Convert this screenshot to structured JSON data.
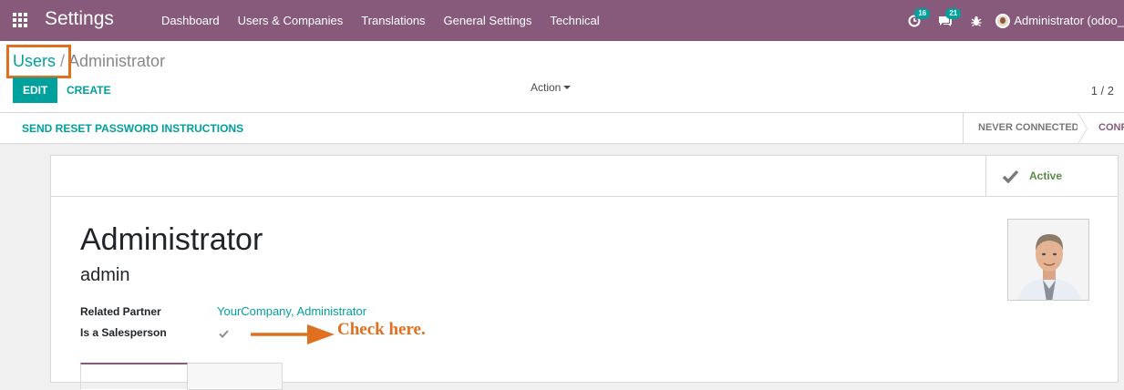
{
  "app": {
    "title": "Settings"
  },
  "menu": {
    "items": [
      {
        "label": "Dashboard"
      },
      {
        "label": "Users & Companies"
      },
      {
        "label": "Translations"
      },
      {
        "label": "General Settings"
      },
      {
        "label": "Technical"
      }
    ]
  },
  "systray": {
    "activity_count": "16",
    "messages_count": "21",
    "user_label": "Administrator (odoo_"
  },
  "breadcrumb": {
    "parent": "Users",
    "separator": "/",
    "current": "Administrator"
  },
  "toolbar": {
    "edit_label": "EDIT",
    "create_label": "CREATE",
    "action_label": "Action",
    "pager": "1 / 2"
  },
  "statusbar": {
    "reset_password_label": "SEND RESET PASSWORD INSTRUCTIONS",
    "stages": [
      {
        "label": "NEVER CONNECTED"
      },
      {
        "label": "CONFIRMED"
      }
    ]
  },
  "form": {
    "active_button_label": "Active",
    "name": "Administrator",
    "login": "admin",
    "fields": {
      "related_partner_label": "Related Partner",
      "related_partner_value": "YourCompany, Administrator",
      "is_salesperson_label": "Is a Salesperson",
      "is_salesperson_checked": true
    }
  },
  "annotation": {
    "text": "Check here.",
    "color": "#e0701f"
  },
  "colors": {
    "navbar": "#875a7b",
    "accent": "#00a09d",
    "active_green": "#5a8a44"
  }
}
